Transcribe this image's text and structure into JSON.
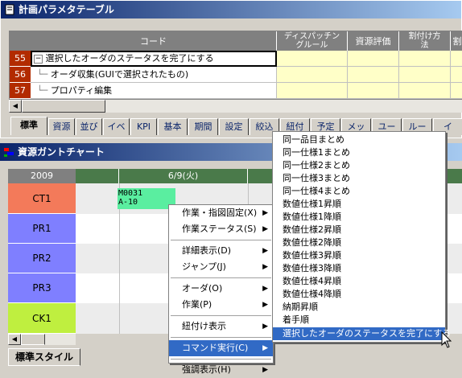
{
  "top_window": {
    "title": "計画パラメタテーブル"
  },
  "param_table": {
    "columns": [
      "コード",
      "ディスパッチン\nグルール",
      "資源評価",
      "割付け方\n法",
      "割"
    ],
    "rows": [
      {
        "num": "55",
        "label": "選択したオーダのステータスを完了にする",
        "expander": "−"
      },
      {
        "num": "56",
        "label": "オーダ収集(GUIで選択されたもの)"
      },
      {
        "num": "57",
        "label": "プロパティ編集"
      }
    ]
  },
  "tabs": [
    "標準",
    "資源",
    "並び",
    "イベ",
    "KPI",
    "基本",
    "期間",
    "設定",
    "絞込",
    "紐付",
    "予定",
    "メッ",
    "ユー",
    "ルー",
    "イ"
  ],
  "gantt_window": {
    "title": "資源ガントチャート"
  },
  "gantt": {
    "year": "2009",
    "date_label": "6/9(火)",
    "resources": [
      {
        "name": "CT1",
        "color": "#f37a5a"
      },
      {
        "name": "PR1",
        "color": "#7f7fff"
      },
      {
        "name": "PR2",
        "color": "#7f7fff"
      },
      {
        "name": "PR3",
        "color": "#7f7fff"
      },
      {
        "name": "CK1",
        "color": "#bfef3f"
      }
    ],
    "bar_label_1": "M0031",
    "bar_label_2": "A-10",
    "bottom_tab": "標準スタイル"
  },
  "context_menu": {
    "items": [
      {
        "label": "作業・指図固定(X)",
        "arrow": "▶"
      },
      {
        "label": "作業ステータス(S)",
        "arrow": "▶"
      },
      {
        "sep": true
      },
      {
        "label": "詳細表示(D)",
        "arrow": "▶"
      },
      {
        "label": "ジャンプ(J)",
        "arrow": "▶"
      },
      {
        "sep": true
      },
      {
        "label": "オーダ(O)",
        "arrow": "▶"
      },
      {
        "label": "作業(P)",
        "arrow": "▶"
      },
      {
        "sep": true
      },
      {
        "label": "紐付け表示",
        "arrow": "▶"
      },
      {
        "sep": true
      },
      {
        "label": "コマンド実行(C)",
        "arrow": "▶",
        "selected": true
      },
      {
        "sep": true
      },
      {
        "label": "強調表示(H)",
        "arrow": "▶"
      }
    ]
  },
  "submenu": {
    "items": [
      "同一品目まとめ",
      "同一仕様1まとめ",
      "同一仕様2まとめ",
      "同一仕様3まとめ",
      "同一仕様4まとめ",
      "数値仕様1昇順",
      "数値仕様1降順",
      "数値仕様2昇順",
      "数値仕様2降順",
      "数値仕様3昇順",
      "数値仕様3降順",
      "数値仕様4昇順",
      "数値仕様4降順",
      "納期昇順",
      "着手順",
      "選択したオーダのステータスを完了にする"
    ],
    "selected_index": 15
  },
  "colors": {
    "rownum": "#b22b00",
    "titlebar": "#0a246a",
    "selection": "#316ac5"
  }
}
